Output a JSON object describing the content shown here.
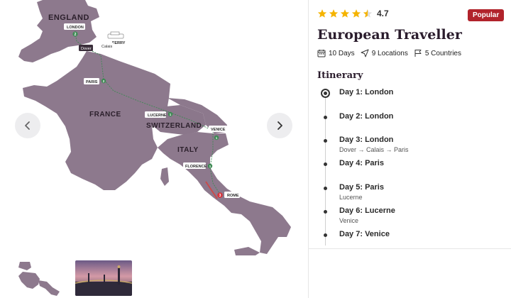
{
  "map": {
    "countries": [
      "ENGLAND",
      "FRANCE",
      "SWITZERLAND",
      "ITALY"
    ],
    "cities": {
      "london": "LONDON",
      "dover": "Dover",
      "calais": "Calais",
      "ferry": "FERRY",
      "paris": "PARIS",
      "lucerne": "LUCERNE",
      "venice": "VENICE",
      "florence": "FLORENCE",
      "rome": "ROME"
    },
    "stop_counts": {
      "london": "2",
      "paris": "2",
      "lucerne": "1",
      "venice": "1",
      "florence": "1",
      "rome": "3"
    },
    "land_color": "#8d798d",
    "route_color": "#3d8a53",
    "end_marker_color": "#d6323a"
  },
  "nav": {
    "prev_icon": "chevron-left-icon",
    "next_icon": "chevron-right-icon"
  },
  "rating": {
    "value": "4.7",
    "stars_filled": 4.5,
    "star_color": "#f5b400"
  },
  "badge": "Popular",
  "title": "European Traveller",
  "meta": {
    "days": "10 Days",
    "locations": "9 Locations",
    "countries": "5 Countries"
  },
  "itinerary": {
    "heading": "Itinerary",
    "days": [
      {
        "label": "Day 1: London",
        "sub": "",
        "active": true
      },
      {
        "label": "Day 2: London",
        "sub": ""
      },
      {
        "label": "Day 3: London",
        "sub": "Dover → Calais → Paris"
      },
      {
        "label": "Day 4: Paris",
        "sub": ""
      },
      {
        "label": "Day 5: Paris",
        "sub": "Lucerne"
      },
      {
        "label": "Day 6: Lucerne",
        "sub": "Venice"
      },
      {
        "label": "Day 7: Venice",
        "sub": ""
      }
    ]
  },
  "thumbnails": [
    "map-thumbnail",
    "bridge-photo-thumbnail"
  ]
}
